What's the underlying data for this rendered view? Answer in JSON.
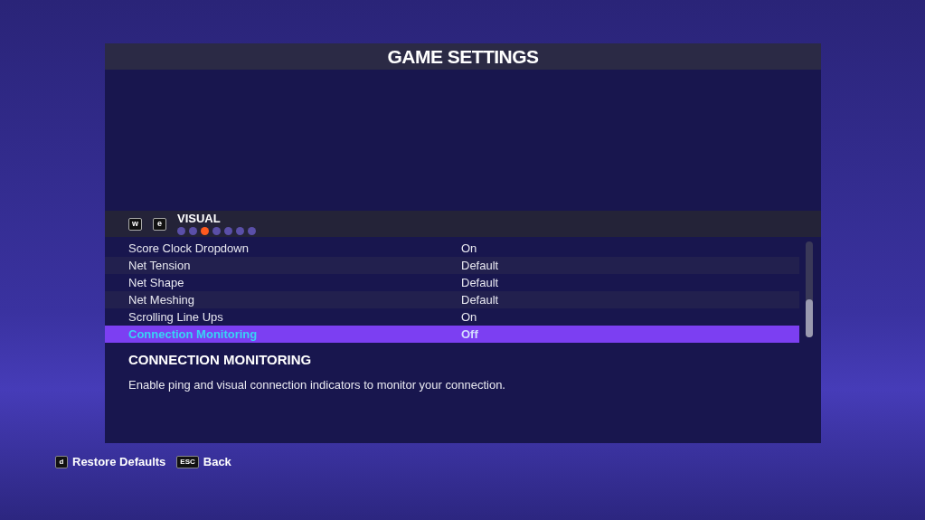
{
  "window": {
    "title": "GAME SETTINGS"
  },
  "section": {
    "prev_key": "w",
    "next_key": "e",
    "title": "VISUAL",
    "pages": [
      {
        "selected": false
      },
      {
        "selected": false
      },
      {
        "selected": true
      },
      {
        "selected": false
      },
      {
        "selected": false
      },
      {
        "selected": false
      },
      {
        "selected": false
      }
    ]
  },
  "settings": [
    {
      "label": "Score Clock Dropdown",
      "value": "On",
      "selected": false
    },
    {
      "label": "Net Tension",
      "value": "Default",
      "selected": false
    },
    {
      "label": "Net Shape",
      "value": "Default",
      "selected": false
    },
    {
      "label": "Net Meshing",
      "value": "Default",
      "selected": false
    },
    {
      "label": "Scrolling Line Ups",
      "value": "On",
      "selected": false
    },
    {
      "label": "Connection Monitoring",
      "value": "Off",
      "selected": true
    }
  ],
  "description": {
    "title": "CONNECTION MONITORING",
    "text": "Enable ping and visual connection indicators to monitor your connection."
  },
  "footer": [
    {
      "key": "d",
      "label": "Restore Defaults"
    },
    {
      "key": "ESC",
      "label": "Back"
    }
  ]
}
